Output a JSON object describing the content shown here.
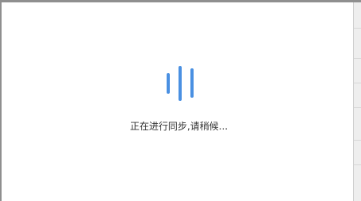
{
  "dialog": {
    "status_text": "正在进行同步,请稍候..."
  },
  "spinner": {
    "icon": "loading-bars-icon",
    "color": "#4a90e2"
  },
  "colors": {
    "background": "#ffffff",
    "chrome": "#8f8f8f"
  }
}
